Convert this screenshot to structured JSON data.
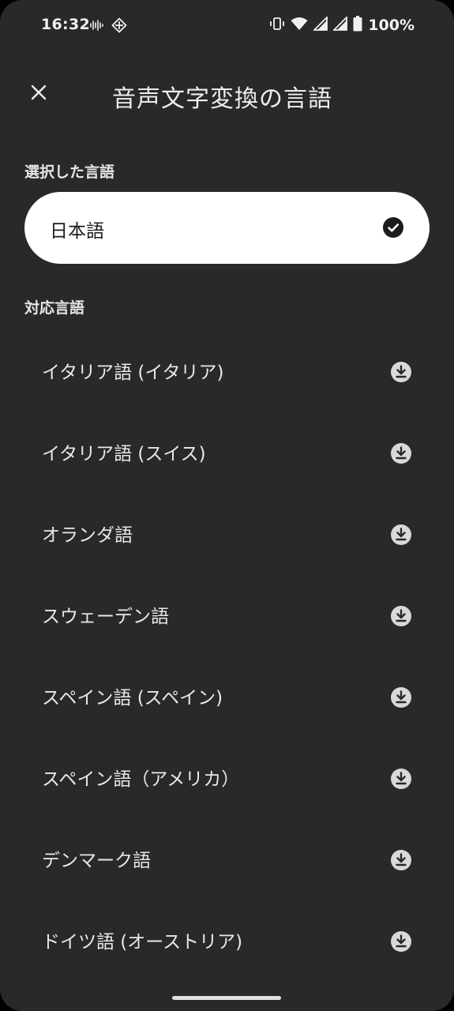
{
  "status_bar": {
    "time": "16:32",
    "battery_text": "100%",
    "left_icons": [
      "audio-wave-icon",
      "diamond-grid-icon"
    ],
    "right_icons": [
      "vibrate-icon",
      "wifi-icon",
      "signal-icon",
      "signal-icon",
      "battery-icon"
    ]
  },
  "header": {
    "title": "音声文字変換の言語",
    "close_icon": "close-icon"
  },
  "selected_section": {
    "label": "選択した言語",
    "language": "日本語",
    "check_icon": "check-circle-icon"
  },
  "supported_section": {
    "label": "対応言語",
    "items": [
      {
        "label": "イタリア語 (イタリア)",
        "icon": "download-icon"
      },
      {
        "label": "イタリア語 (スイス)",
        "icon": "download-icon"
      },
      {
        "label": "オランダ語",
        "icon": "download-icon"
      },
      {
        "label": "スウェーデン語",
        "icon": "download-icon"
      },
      {
        "label": "スペイン語 (スペイン)",
        "icon": "download-icon"
      },
      {
        "label": "スペイン語（アメリカ）",
        "icon": "download-icon"
      },
      {
        "label": "デンマーク語",
        "icon": "download-icon"
      },
      {
        "label": "ドイツ語 (オーストリア)",
        "icon": "download-icon"
      }
    ]
  },
  "colors": {
    "background": "#292929",
    "card": "#ffffff",
    "text": "#e8e8e8",
    "icon_fill": "#d9d9d9"
  }
}
